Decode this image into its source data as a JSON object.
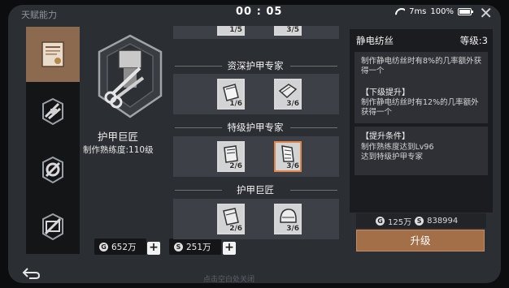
{
  "window": {
    "title": "天赋能力",
    "timer": "00 : 05",
    "ping": "7ms",
    "battery": "100%"
  },
  "sidebar": {
    "items": [
      {
        "id": "certificate",
        "icon": "certificate-icon",
        "active": true
      },
      {
        "id": "weapon-craft",
        "icon": "weapon-craft-icon",
        "active": false
      },
      {
        "id": "gear-craft",
        "icon": "gear-craft-icon",
        "active": false
      },
      {
        "id": "blueprint-craft",
        "icon": "blueprint-craft-icon",
        "active": false
      }
    ]
  },
  "hero": {
    "name": "护甲巨匠",
    "proficiency": "制作熟练度:110级"
  },
  "currencies": [
    {
      "icon": "G",
      "value": "652万"
    },
    {
      "icon": "S",
      "value": "251万"
    }
  ],
  "tiers": [
    {
      "title": "",
      "cards": [
        {
          "level": "1/5"
        },
        {
          "level": "3/5"
        }
      ]
    },
    {
      "title": "资深护甲专家",
      "cards": [
        {
          "level": "1/6"
        },
        {
          "level": "3/6"
        }
      ]
    },
    {
      "title": "特级护甲专家",
      "cards": [
        {
          "level": "2/6"
        },
        {
          "level": "3/6",
          "selected": true
        }
      ]
    },
    {
      "title": "护甲巨匠",
      "cards": [
        {
          "level": "2/6"
        },
        {
          "level": "3/6"
        }
      ]
    }
  ],
  "detail": {
    "name": "静电纺丝",
    "level": "等级:3",
    "current": "制作静电纺丝时有8%的几率额外获得一个",
    "next_head": "【下级提升】",
    "next_text": "制作静电纺丝时有12%的几率额外获得一个",
    "cond_head": "【提升条件】",
    "cond_lines": [
      "制作熟练度达到Lv96",
      "达到特级护甲专家"
    ]
  },
  "cost": {
    "gold": "125万",
    "silver": "838994"
  },
  "actions": {
    "upgrade": "升级"
  },
  "footer": "点击空白处关闭",
  "colors": {
    "accent": "#a36f48",
    "active_tab": "#8b6a50",
    "selected_card": "#e2874a"
  }
}
